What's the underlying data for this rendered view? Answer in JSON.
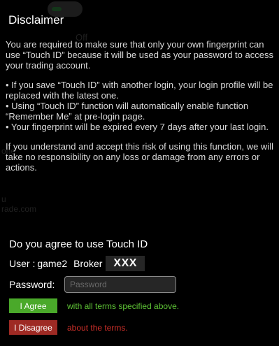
{
  "background_ghost": {
    "off_text": "Off",
    "fragment_one": "one",
    "fragment_rade": "rade.com",
    "fragment_u": "u"
  },
  "dialog": {
    "title": "Disclaimer",
    "paragraphs": [
      "You are required to make sure that only your own fingerprint can use “Touch ID” because it will be used as your password to access your trading account.",
      "• If you save “Touch ID” with another login, your login profile will be replaced with the latest one.\n• Using “Touch ID” function will automatically enable function “Remember Me” at pre-login page.\n• Your fingerprint will be expired every 7 days after your last login.",
      "If you understand and accept this risk of using this function, we will take no responsibility on any loss or damage from any errors or actions."
    ],
    "question": "Do you agree to use Touch ID",
    "user_label": "User :",
    "user_value": "game2",
    "broker_label": "Broker",
    "broker_value": "XXX",
    "password_label": "Password:",
    "password_placeholder": "Password",
    "password_value": "",
    "agree_button": "I Agree",
    "agree_note": "with all terms specified above.",
    "disagree_button": "I Disagree",
    "disagree_note": "about the terms."
  },
  "colors": {
    "background": "#000000",
    "agree_green": "#4aa92a",
    "agree_text_green": "#5fc536",
    "disagree_red": "#9e2a24",
    "disagree_text_red": "#d0302a",
    "input_background": "#262626"
  }
}
